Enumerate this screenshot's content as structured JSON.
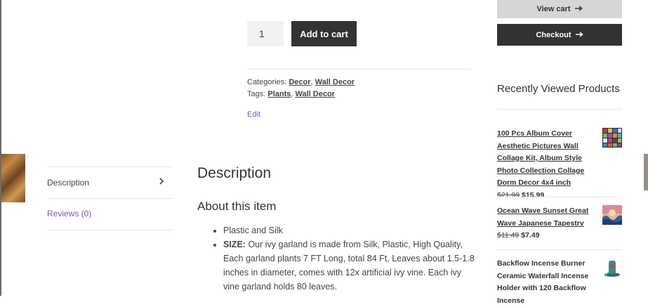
{
  "product": {
    "quantity": "1",
    "add_to_cart": "Add to cart",
    "categories_label": "Categories:",
    "categories": [
      "Decor",
      "Wall Decor"
    ],
    "tags_label": "Tags:",
    "tags": [
      "Plants",
      "Wall Decor"
    ],
    "edit": "Edit"
  },
  "tabs": [
    {
      "label": "Description",
      "icon": "chevron-right-icon"
    },
    {
      "label": "Reviews (0)"
    }
  ],
  "description": {
    "title": "Description",
    "subtitle": "About this item",
    "bullets": [
      {
        "bold": "",
        "text": "Plastic and Silk"
      },
      {
        "bold": "SIZE:",
        "text": "Our ivy garland is made from Silk, Plastic, High Quality, Each garland plants 7 FT Long, total 84 Ft, Leaves about 1.5-1.8 inches in diameter, comes with 12x artificial ivy vine. Each ivy vine garland holds 80 leaves."
      }
    ]
  },
  "sidebar": {
    "view_cart": "View cart",
    "checkout": "Checkout",
    "recent_title": "Recently Viewed Products",
    "products": [
      {
        "name": "100 Pcs Album Cover Aesthetic Pictures Wall Collage Kit, Album Style Photo Collection Collage Dorm Decor 4x4 inch",
        "old_price": "$21.99",
        "price": "$15.99"
      },
      {
        "name": "Ocean Wave Sunset Great Wave Japanese Tapestry",
        "old_price": "$11.49",
        "price": "$7.49"
      },
      {
        "name": "Backflow Incense Burner Ceramic Waterfall Incense Holder with 120 Backflow Incense",
        "old_price": "",
        "price": ""
      }
    ]
  },
  "colors": {
    "link_purple": "#7f54b3",
    "button_dark": "#333333",
    "button_light": "#d6d6d6"
  }
}
